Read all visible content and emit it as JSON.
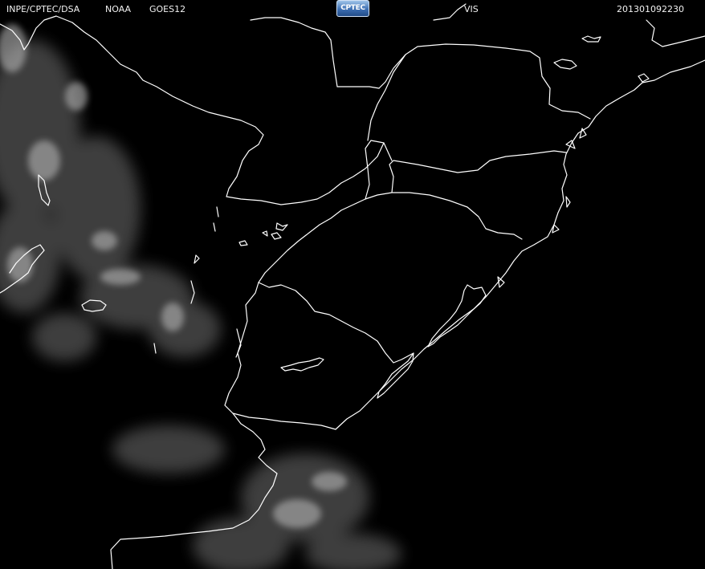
{
  "header": {
    "credit": "INPE/CPTEC/DSA",
    "agency": "NOAA",
    "satellite": "GOES12",
    "logo_text": "CPTEC",
    "channel": "VIS",
    "timestamp": "201301092230"
  },
  "map": {
    "background_color": "#000000",
    "boundary_color": "#ffffff",
    "cloud_color": "#9a9a9a",
    "region": "Southern Brazil / Uruguay / Paraguay / NE Argentina"
  }
}
